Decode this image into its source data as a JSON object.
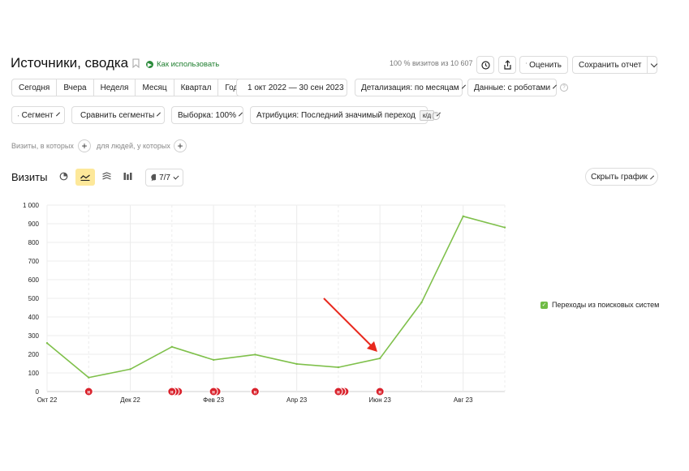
{
  "header": {
    "title": "Источники, сводка",
    "how_to": "Как использовать",
    "visits_pct": "100 % визитов из 10 607",
    "rate_label": "Оценить",
    "save_report": "Сохранить отчет"
  },
  "periods": [
    "Сегодня",
    "Вчера",
    "Неделя",
    "Месяц",
    "Квартал",
    "Год"
  ],
  "filters": {
    "date_range": "1 окт 2022 — 30 сен 2023",
    "detail": "Детализация: по месяцам",
    "data": "Данные: с роботами",
    "segment": "Сегмент",
    "compare": "Сравнить сегменты",
    "sample": "Выборка: 100%",
    "attribution": "Атрибуция: Последний значимый переход",
    "attribution_badge": "к/д"
  },
  "conditions": {
    "visits_where": "Визиты, в которых",
    "people_where": "для людей, у которых"
  },
  "chart_header": {
    "title": "Визиты",
    "annotations_count": "7/7",
    "hide_chart": "Скрыть график"
  },
  "colors": {
    "line": "#7fc04b",
    "accent_yellow": "#fde89a",
    "annotation_red": "#d9232d",
    "arrow": "#e8291e"
  },
  "chart_data": {
    "type": "line",
    "yticks": [
      "0",
      "100",
      "200",
      "300",
      "400",
      "500",
      "600",
      "700",
      "800",
      "900",
      "1 000"
    ],
    "ylim": [
      0,
      1000
    ],
    "xticks": [
      {
        "label": "Окт 22",
        "index": 0
      },
      {
        "label": "Дек 22",
        "index": 2
      },
      {
        "label": "Фев 23",
        "index": 4
      },
      {
        "label": "Апр 23",
        "index": 6
      },
      {
        "label": "Июн 23",
        "index": 8
      },
      {
        "label": "Авг 23",
        "index": 10
      }
    ],
    "series": [
      {
        "name": "Переходы из поисковых систем",
        "values": [
          260,
          75,
          120,
          240,
          170,
          198,
          148,
          130,
          178,
          478,
          940,
          880
        ]
      }
    ],
    "legend_position": "right",
    "annotation_markers": [
      {
        "index": 1,
        "count": 1
      },
      {
        "index": 3,
        "count": 3
      },
      {
        "index": 4,
        "count": 2
      },
      {
        "index": 5,
        "count": 1
      },
      {
        "index": 7,
        "count": 3
      },
      {
        "index": 8,
        "count": 1
      }
    ],
    "marker_glyph": "н"
  }
}
